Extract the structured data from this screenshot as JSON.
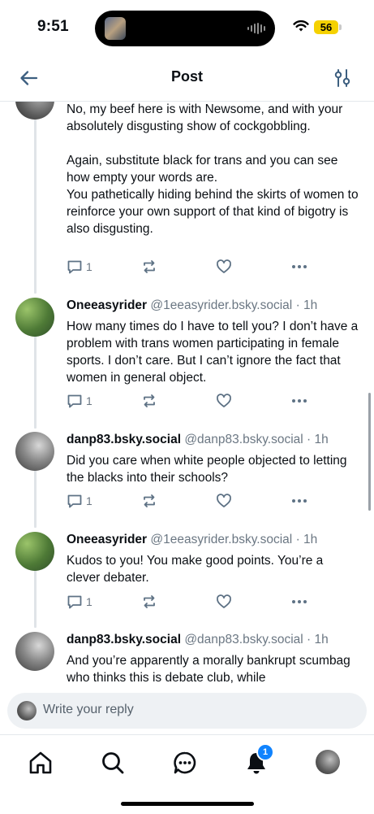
{
  "status_bar": {
    "time": "9:51",
    "battery": "56"
  },
  "header": {
    "title": "Post"
  },
  "first_post": {
    "paragraphs": [
      "No, my beef here is with Newsome, and with your absolutely disgusting show of cockgobbling.",
      "",
      "Again, substitute black for trans and you can see how empty your words are.",
      "You pathetically hiding behind the skirts of women to reinforce your own support of that kind of bigotry is also disgusting."
    ],
    "reply_count": "1"
  },
  "posts": [
    {
      "author": "Oneeasyrider",
      "handle": "@1eeasyrider.bsky.social",
      "time": "1h",
      "text": "How many times do I have to tell you?  I don’t have a problem with trans women participating in female sports.  I don’t care.  But I can’t ignore the fact that women in general object.",
      "reply_count": "1"
    },
    {
      "author": "danp83.bsky.social",
      "handle": "@danp83.bsky.social",
      "time": "1h",
      "text": "Did you care when white people objected to letting the blacks into their schools?",
      "reply_count": "1"
    },
    {
      "author": "Oneeasyrider",
      "handle": "@1eeasyrider.bsky.social",
      "time": "1h",
      "text": "Kudos to you!  You make good points.  You’re a clever debater.",
      "reply_count": "1"
    },
    {
      "author": "danp83.bsky.social",
      "handle": "@danp83.bsky.social",
      "time": "1h",
      "text": "And you’re apparently a morally bankrupt scumbag who thinks this is debate club, while",
      "reply_count": ""
    }
  ],
  "reply": {
    "placeholder": "Write your reply"
  },
  "nav": {
    "notifications_badge": "1"
  },
  "colors": {
    "accent": "#1083fe",
    "muted": "#6b7783",
    "battery": "#f5d100"
  }
}
